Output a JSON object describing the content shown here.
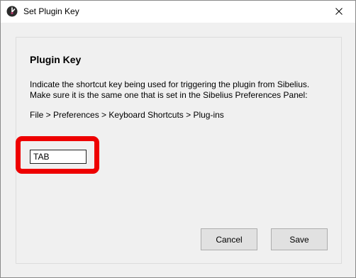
{
  "window": {
    "title": "Set Plugin Key",
    "app_icon": "sibelius-logo-icon",
    "close_icon": "close-icon"
  },
  "panel": {
    "heading": "Plugin Key",
    "description_lines": [
      "Indicate the shortcut key being used for triggering the plugin from Sibelius.",
      "Make sure it is the same one that is set in the Sibelius Preferences Panel:"
    ],
    "menu_path": "File > Preferences > Keyboard Shortcuts > Plug-ins",
    "key_field": {
      "value": "TAB"
    },
    "highlight_color": "#ee0000"
  },
  "buttons": {
    "cancel_label": "Cancel",
    "save_label": "Save"
  }
}
